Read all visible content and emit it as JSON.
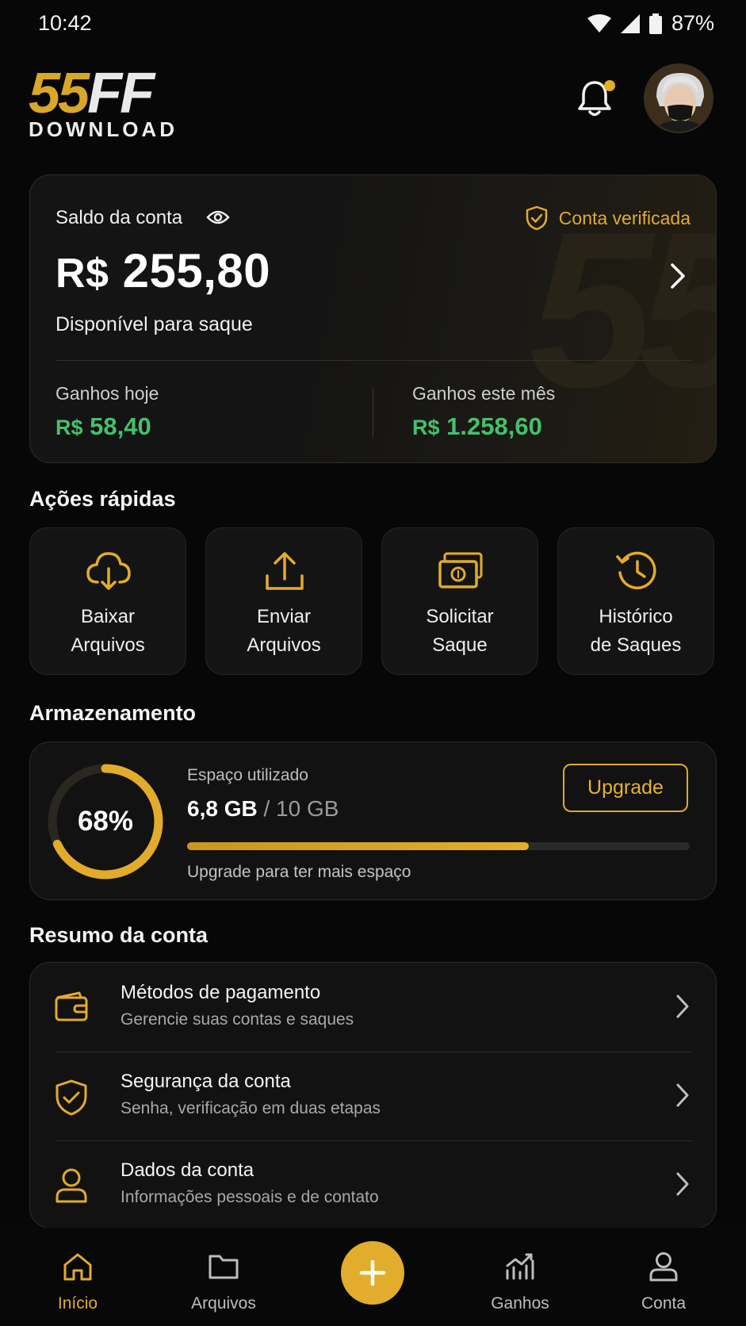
{
  "status_bar": {
    "time": "10:42",
    "battery": "87%"
  },
  "header": {
    "logo_number": "55",
    "logo_letters": "FF",
    "logo_subtitle": "DOWNLOAD",
    "notification_dot": true
  },
  "balance": {
    "label": "Saldo da conta",
    "verified": "Conta verificada",
    "currency": "R$",
    "amount": "255,80",
    "subtitle": "Disponível para saque",
    "today_label": "Ganhos hoje",
    "today_currency": "R$",
    "today_value": "58,40",
    "month_label": "Ganhos este mês",
    "month_currency": "R$",
    "month_value": "1.258,60"
  },
  "quick_actions": {
    "title": "Ações rápidas",
    "items": [
      {
        "line1": "Baixar",
        "line2": "Arquivos",
        "icon": "cloud-download-icon"
      },
      {
        "line1": "Enviar",
        "line2": "Arquivos",
        "icon": "upload-icon"
      },
      {
        "line1": "Solicitar",
        "line2": "Saque",
        "icon": "cash-icon"
      },
      {
        "line1": "Histórico",
        "line2": "de Saques",
        "icon": "history-icon"
      }
    ]
  },
  "storage": {
    "title": "Armazenamento",
    "percent_label": "68%",
    "used_fraction": 0.68,
    "space_label": "Espaço utilizado",
    "used": "6,8 GB",
    "total": "/ 10 GB",
    "hint": "Upgrade para ter mais espaço",
    "upgrade_label": "Upgrade"
  },
  "summary": {
    "title": "Resumo da conta",
    "items": [
      {
        "title": "Métodos de pagamento",
        "subtitle": "Gerencie suas contas e saques",
        "icon": "wallet-icon"
      },
      {
        "title": "Segurança da conta",
        "subtitle": "Senha, verificação em duas etapas",
        "icon": "shield-check-icon"
      },
      {
        "title": "Dados da conta",
        "subtitle": "Informações pessoais e de contato",
        "icon": "user-icon"
      }
    ]
  },
  "bottom_nav": {
    "items": [
      {
        "label": "Início",
        "icon": "home-icon",
        "active": true
      },
      {
        "label": "Arquivos",
        "icon": "folder-icon"
      },
      {
        "label": "Ganhos",
        "icon": "chart-icon"
      },
      {
        "label": "Conta",
        "icon": "user-icon"
      }
    ],
    "fab_icon": "plus-icon"
  },
  "colors": {
    "accent": "#e2ab2c",
    "positive": "#46c06a",
    "background": "#070708",
    "card": "#121212"
  }
}
